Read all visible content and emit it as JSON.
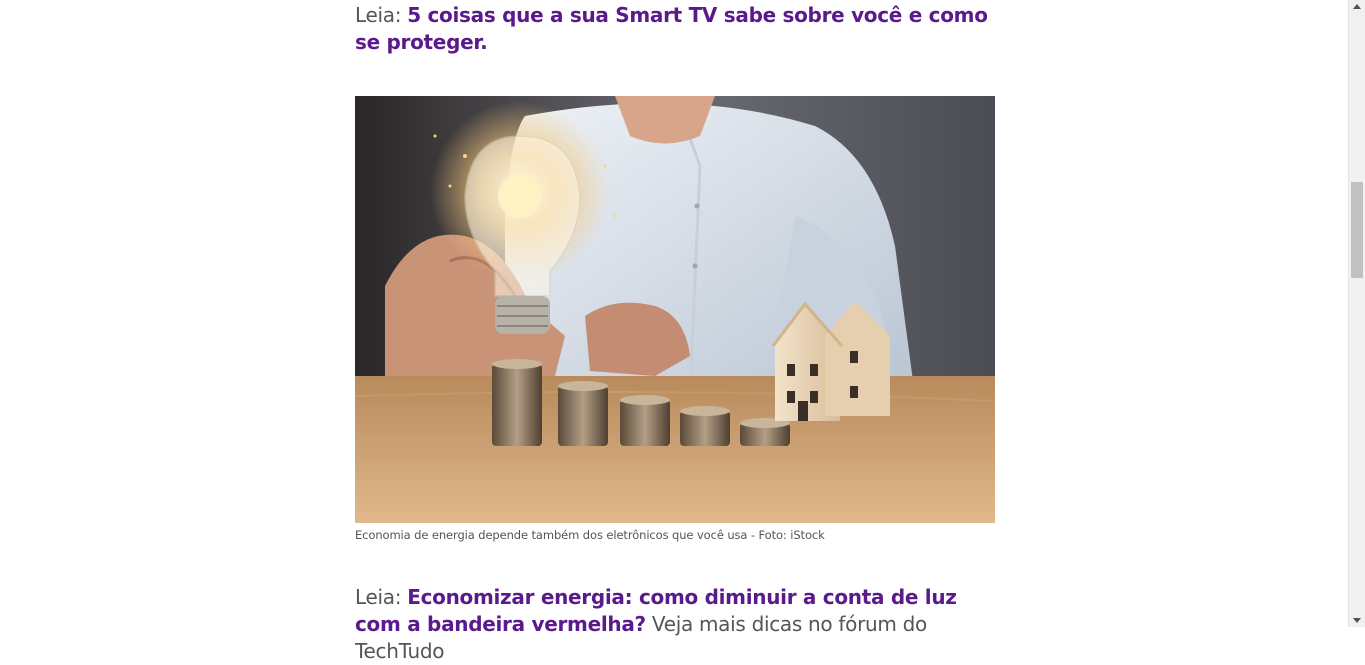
{
  "article": {
    "read_more_top": {
      "prefix": "Leia:",
      "link": "5 coisas que a sua Smart TV sabe sobre você e como se proteger."
    },
    "image": {
      "alt": "Mão segurando lâmpada acesa sobre pilhas de moedas e casas de madeira",
      "caption": "Economia de energia depende também dos eletrônicos que você usa - Foto: iStock"
    },
    "read_more_bottom": {
      "prefix": "Leia:",
      "link": "Economizar energia: como diminuir a conta de luz com a bandeira vermelha?",
      "tail": "Veja mais dicas no fórum do TechTudo"
    }
  },
  "colors": {
    "link": "#5a1a8c",
    "text": "#555555"
  },
  "icons": {
    "scroll_up": "arrow-up-icon",
    "scroll_down": "arrow-down-icon"
  }
}
